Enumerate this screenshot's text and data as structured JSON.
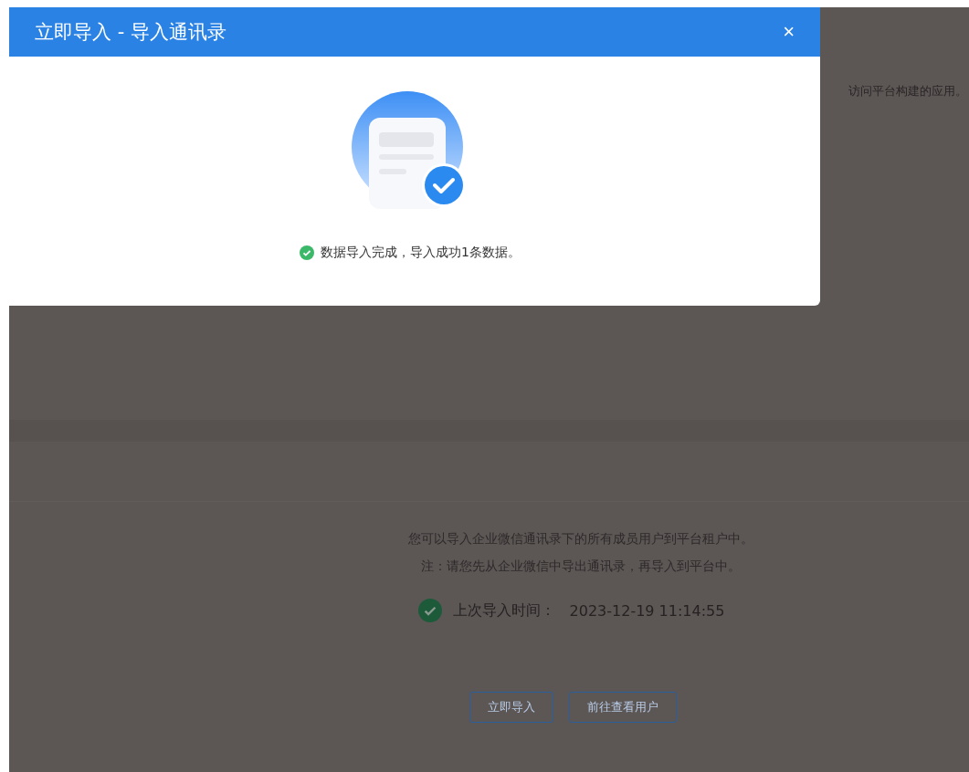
{
  "background_page": {
    "intro_tail": "访问平台构建的应用。",
    "description": "您可以导入企业微信通讯录下的所有成员用户到平台租户中。",
    "note": "注：请您先从企业微信中导出通讯录，再导入到平台中。",
    "last_import": {
      "label": "上次导入时间：",
      "value": "2023-12-19 11:14:55"
    },
    "buttons": [
      "立即导入",
      "前往查看用户"
    ]
  },
  "dialog": {
    "title": "立即导入 - 导入通讯录",
    "close": "×",
    "message": "数据导入完成，导入成功1条数据。"
  }
}
